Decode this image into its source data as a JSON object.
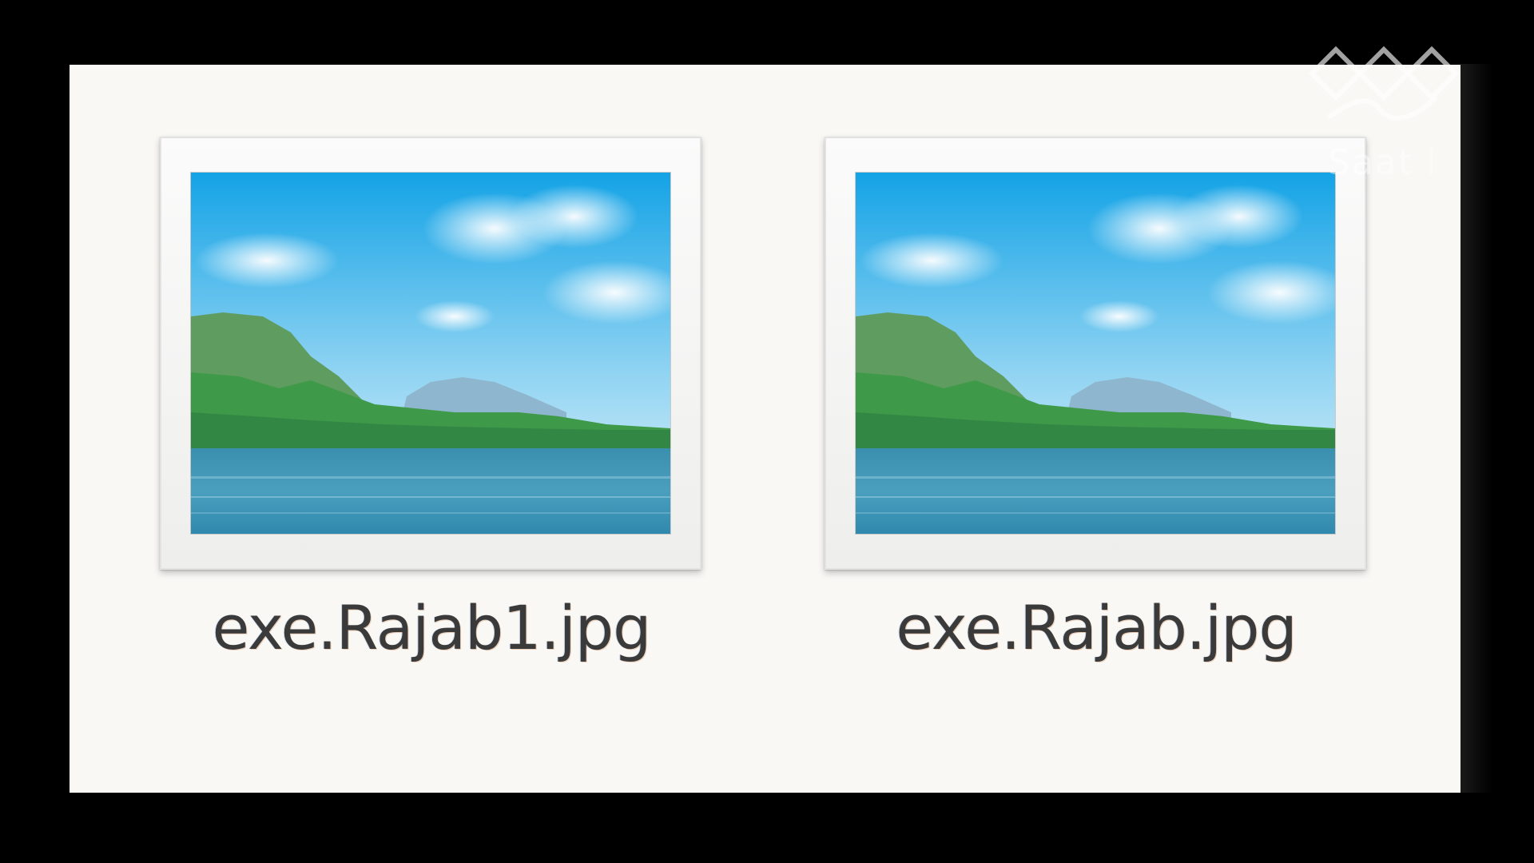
{
  "files": [
    {
      "name": "exe.Rajab1.jpg",
      "icon": "landscape-image-icon"
    },
    {
      "name": "exe.Rajab.jpg",
      "icon": "landscape-image-icon"
    }
  ],
  "watermark": {
    "text": "Saat l",
    "icon": "logo-mark"
  },
  "colors": {
    "pane_background": "#f9f8f5",
    "screen_background": "#000000",
    "sky_top": "#1aa6e8",
    "water": "#2f8fb0",
    "hills": "#3f9a4c",
    "label_text": "#3a3a3a"
  }
}
